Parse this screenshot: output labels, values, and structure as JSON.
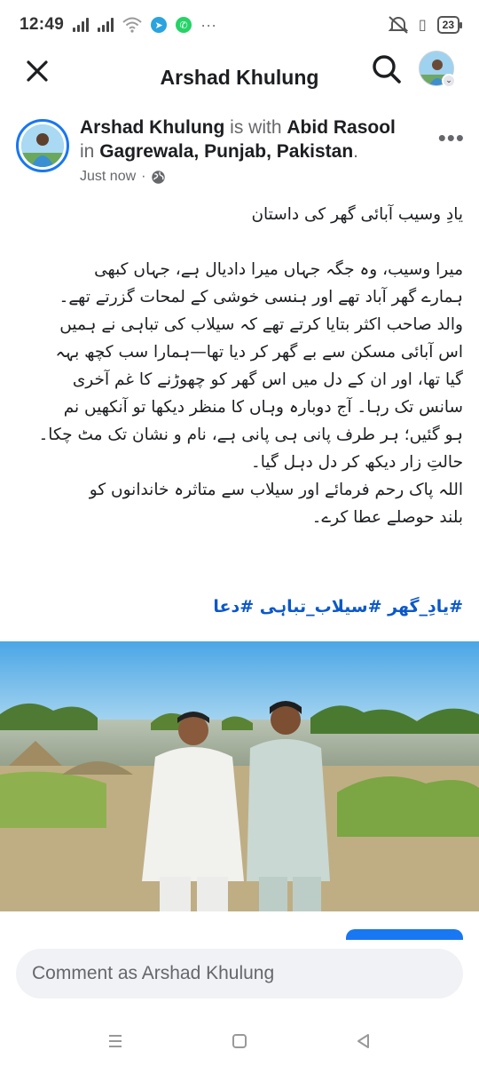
{
  "status_bar": {
    "time": "12:49",
    "battery": "23"
  },
  "app_bar": {
    "title": "Arshad Khulung"
  },
  "post": {
    "author": "Arshad Khulung",
    "with_text": "is with",
    "tagged": "Abid Rasool",
    "in_text": "in",
    "location": "Gagrewala, Punjab, Pakistan",
    "time": "Just now",
    "audience_icon": "globe-icon",
    "title_line": "یادِ وسیب آبائی گھر کی داستان",
    "body_lines": [
      "میرا وسیب، وہ جگہ جہاں میرا دادیال ہے، جہاں کبھی",
      "ہمارے گھر آباد تھے اور ہنسی خوشی کے لمحات گزرتے تھے۔",
      "والد صاحب اکثر بتایا کرتے تھے کہ سیلاب کی تباہی نے ہمیں",
      "اس آبائی مسکن سے بے گھر کر دیا تھا—ہمارا سب کچھ بہہ",
      "گیا تھا، اور ان کے دل میں اس گھر کو چھوڑنے کا غم آخری",
      "سانس تک رہا۔ آج دوبارہ وہاں کا منظر دیکھا تو آنکھیں نم",
      "ہو گئیں؛ ہر طرف پانی ہی پانی ہے، نام و نشان تک مٹ چکا۔",
      "حالتِ زار دیکھ کر دل دہل گیا۔",
      "اللہ پاک رحم فرمائے اور سیلاب سے متاثرہ خاندانوں کو",
      "بلند حوصلے عطا کرے۔"
    ],
    "hashtags": "#یادِ_گھر #سیلاب_تباہی #دعا"
  },
  "comment": {
    "placeholder": "Comment as Arshad Khulung"
  },
  "colors": {
    "accent": "#1877f2",
    "hashtag": "#0b58c9",
    "secondary_text": "#65676b"
  }
}
